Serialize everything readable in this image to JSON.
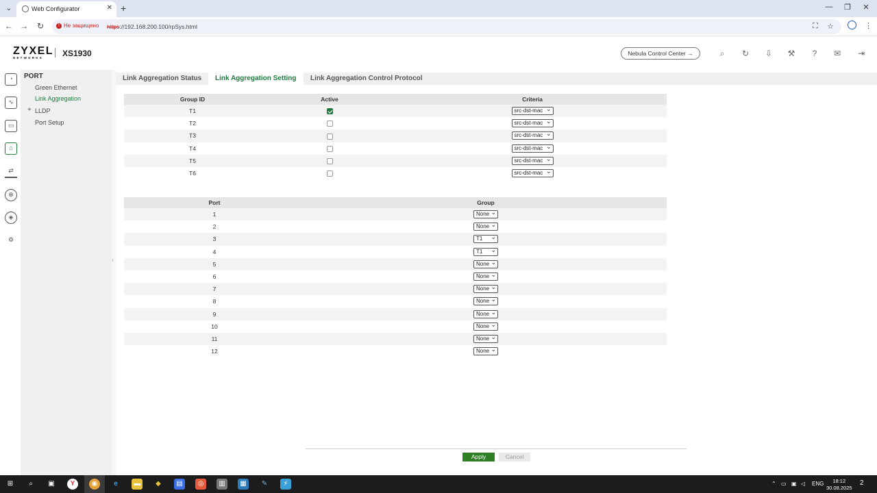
{
  "browser": {
    "tab_title": "Web Configurator",
    "tab_close": "✕",
    "new_tab": "+",
    "menu_glyph": "⌄",
    "window_controls": [
      "—",
      "❐",
      "✕"
    ],
    "nav_back": "←",
    "nav_forward": "→",
    "nav_reload": "↻",
    "security_label": "Не защищено",
    "url_scheme": "https",
    "url_rest": "://192.168.200.100/rpSys.html",
    "icons": [
      "translate-icon",
      "star-icon",
      "profile-icon",
      "kebab-menu-icon"
    ]
  },
  "header": {
    "logo_main": "ZYXEL",
    "logo_sub": "NETWORKS",
    "model": "XS1930",
    "nebula_label": "Nebula Control Center →",
    "icons": [
      "search-icon",
      "refresh-icon",
      "save-icon",
      "tools-icon",
      "help-icon",
      "feedback-icon",
      "logout-icon"
    ]
  },
  "rail": {
    "icons": [
      "dashboard-icon",
      "monitor-icon",
      "system-icon",
      "port-icon",
      "switching-icon",
      "network-icon",
      "security-icon",
      "maintenance-icon"
    ],
    "active_index": 3
  },
  "sidebar": {
    "title": "PORT",
    "items": [
      {
        "label": "Green Ethernet",
        "active": false,
        "expandable": false
      },
      {
        "label": "Link Aggregation",
        "active": true,
        "expandable": false
      },
      {
        "label": "LLDP",
        "active": false,
        "expandable": true
      },
      {
        "label": "Port Setup",
        "active": false,
        "expandable": false
      }
    ],
    "expand_glyph": "+",
    "collapse_glyph": "‹"
  },
  "content_tabs": [
    {
      "label": "Link Aggregation Status",
      "active": false
    },
    {
      "label": "Link Aggregation Setting",
      "active": true
    },
    {
      "label": "Link Aggregation Control Protocol",
      "active": false
    }
  ],
  "groups_table": {
    "headers": [
      "Group ID",
      "Active",
      "Criteria"
    ],
    "rows": [
      {
        "id": "T1",
        "active": true,
        "criteria": "src-dst-mac"
      },
      {
        "id": "T2",
        "active": false,
        "criteria": "src-dst-mac"
      },
      {
        "id": "T3",
        "active": false,
        "criteria": "src-dst-mac"
      },
      {
        "id": "T4",
        "active": false,
        "criteria": "src-dst-mac"
      },
      {
        "id": "T5",
        "active": false,
        "criteria": "src-dst-mac"
      },
      {
        "id": "T6",
        "active": false,
        "criteria": "src-dst-mac"
      }
    ]
  },
  "ports_table": {
    "headers": [
      "Port",
      "Group"
    ],
    "rows": [
      {
        "port": "1",
        "group": "None"
      },
      {
        "port": "2",
        "group": "None"
      },
      {
        "port": "3",
        "group": "T1"
      },
      {
        "port": "4",
        "group": "T1"
      },
      {
        "port": "5",
        "group": "None"
      },
      {
        "port": "6",
        "group": "None"
      },
      {
        "port": "7",
        "group": "None"
      },
      {
        "port": "8",
        "group": "None"
      },
      {
        "port": "9",
        "group": "None"
      },
      {
        "port": "10",
        "group": "None"
      },
      {
        "port": "11",
        "group": "None"
      },
      {
        "port": "12",
        "group": "None"
      }
    ]
  },
  "actions": {
    "apply_label": "Apply",
    "cancel_label": "Cancel"
  },
  "taskbar": {
    "apps": [
      "start-icon",
      "search-icon",
      "task-view-icon",
      "yandex-browser-icon",
      "chrome-icon",
      "edge-icon",
      "file-explorer-icon",
      "app-icon",
      "save-app-icon",
      "camera-app-icon",
      "app-icon",
      "remote-desktop-icon",
      "notes-icon",
      "network-tool-icon"
    ],
    "tray_lang": "ENG",
    "time": "18:12",
    "date": "30.08.2025",
    "notifications": "2",
    "colors": {
      "background": "#1c1c1c",
      "accent": "#1e7a3d",
      "apply": "#2f7f25"
    }
  }
}
